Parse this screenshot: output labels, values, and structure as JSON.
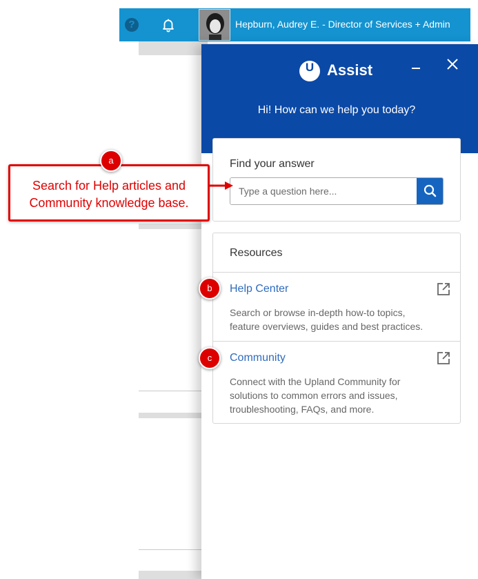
{
  "topbar": {
    "help_icon": "question-circle-icon",
    "help_glyph": "?",
    "bell_icon": "bell-icon",
    "user_label": "Hepburn, Audrey E. - Director of Services + Admin"
  },
  "assist": {
    "title": "Assist",
    "logo_icon": "upland-u-logo",
    "logo_letter": "U",
    "minimize_icon": "minimize-icon",
    "close_icon": "close-icon",
    "greeting": "Hi! How can we help you today?"
  },
  "find": {
    "title": "Find your answer",
    "placeholder": "Type a question here...",
    "search_icon": "search-icon"
  },
  "resources": {
    "title": "Resources",
    "items": [
      {
        "label": "Help Center",
        "description": "Search or browse in-depth how-to topics, feature overviews, guides and best practices.",
        "icon": "external-link-icon"
      },
      {
        "label": "Community",
        "description": "Connect with the Upland Community for solutions to common errors and issues, troubleshooting, FAQs, and more.",
        "icon": "external-link-icon"
      }
    ]
  },
  "annotations": {
    "badges": [
      "a",
      "b",
      "c"
    ],
    "callout_text": "Search for Help articles and Community knowledge base."
  },
  "colors": {
    "topbar": "#1493d0",
    "panel_header": "#0b49a6",
    "search_button": "#1565c0",
    "link": "#2f6bbd",
    "annotation_red": "#e00000"
  }
}
